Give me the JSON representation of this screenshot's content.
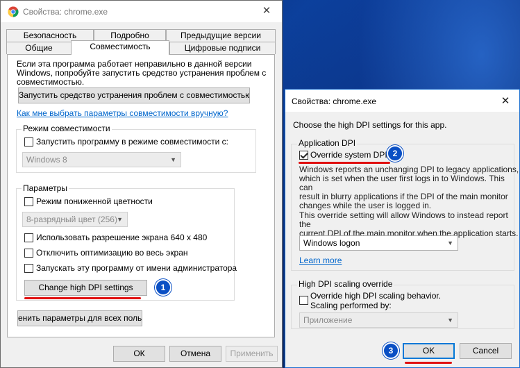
{
  "colors": {
    "accent": "#0078d7",
    "link": "#0066cc",
    "badge": "#0a4fc4",
    "annotation": "#e01010"
  },
  "props_window": {
    "title": "Свойства: chrome.exe",
    "close": "✕",
    "tabs_row1": [
      "Безопасность",
      "Подробно",
      "Предыдущие версии"
    ],
    "tabs_row2": [
      "Общие",
      "Совместимость",
      "Цифровые подписи"
    ],
    "intro": [
      "Если эта программа работает неправильно в данной версии",
      "Windows, попробуйте запустить средство устранения проблем с",
      "совместимостью."
    ],
    "troubleshoot_button": "Запустить средство устранения проблем с совместимостью",
    "manual_link": "Как мне выбрать параметры совместимости вручную?",
    "compat_mode": {
      "label": "Режим совместимости",
      "checkbox": "Запустить программу в режиме совместимости с:",
      "select": "Windows 8"
    },
    "params": {
      "label": "Параметры",
      "reduced_color": "Режим пониженной цветности",
      "color_select": "8-разрядный цвет (256)",
      "res_640": "Использовать разрешение экрана 640 х 480",
      "disable_fullscreen": "Отключить оптимизацию во весь экран",
      "run_admin": "Запускать эту программу от имени администратора",
      "dpi_button": "Change high DPI settings"
    },
    "all_users_button": "енить параметры для всех пользов",
    "ok": "ОК",
    "cancel": "Отмена",
    "apply": "Применить",
    "badge": "1"
  },
  "dpi_window": {
    "title": "Свойства: chrome.exe",
    "close": "✕",
    "intro": "Choose the high DPI settings for this app.",
    "app_dpi": {
      "label": "Application DPI",
      "checkbox": "Override system DPI",
      "checked": true,
      "badge": "2",
      "desc1": [
        "Windows reports an unchanging DPI to legacy applications,",
        "which is set when the user first logs in to Windows. This can",
        "result in blurry applications if the DPI of the main monitor",
        "changes while the user is logged in."
      ],
      "desc2": [
        "This override setting will allow Windows to instead report the",
        "current DPI of the main monitor when the application starts."
      ],
      "select": "Windows logon",
      "learn_more": "Learn more"
    },
    "scaling": {
      "label": "High DPI scaling override",
      "checkbox_line1": "Override high DPI scaling behavior.",
      "checkbox_line2": "Scaling performed by:",
      "select": "Приложение"
    },
    "ok": "OK",
    "cancel": "Cancel",
    "badge": "3"
  }
}
